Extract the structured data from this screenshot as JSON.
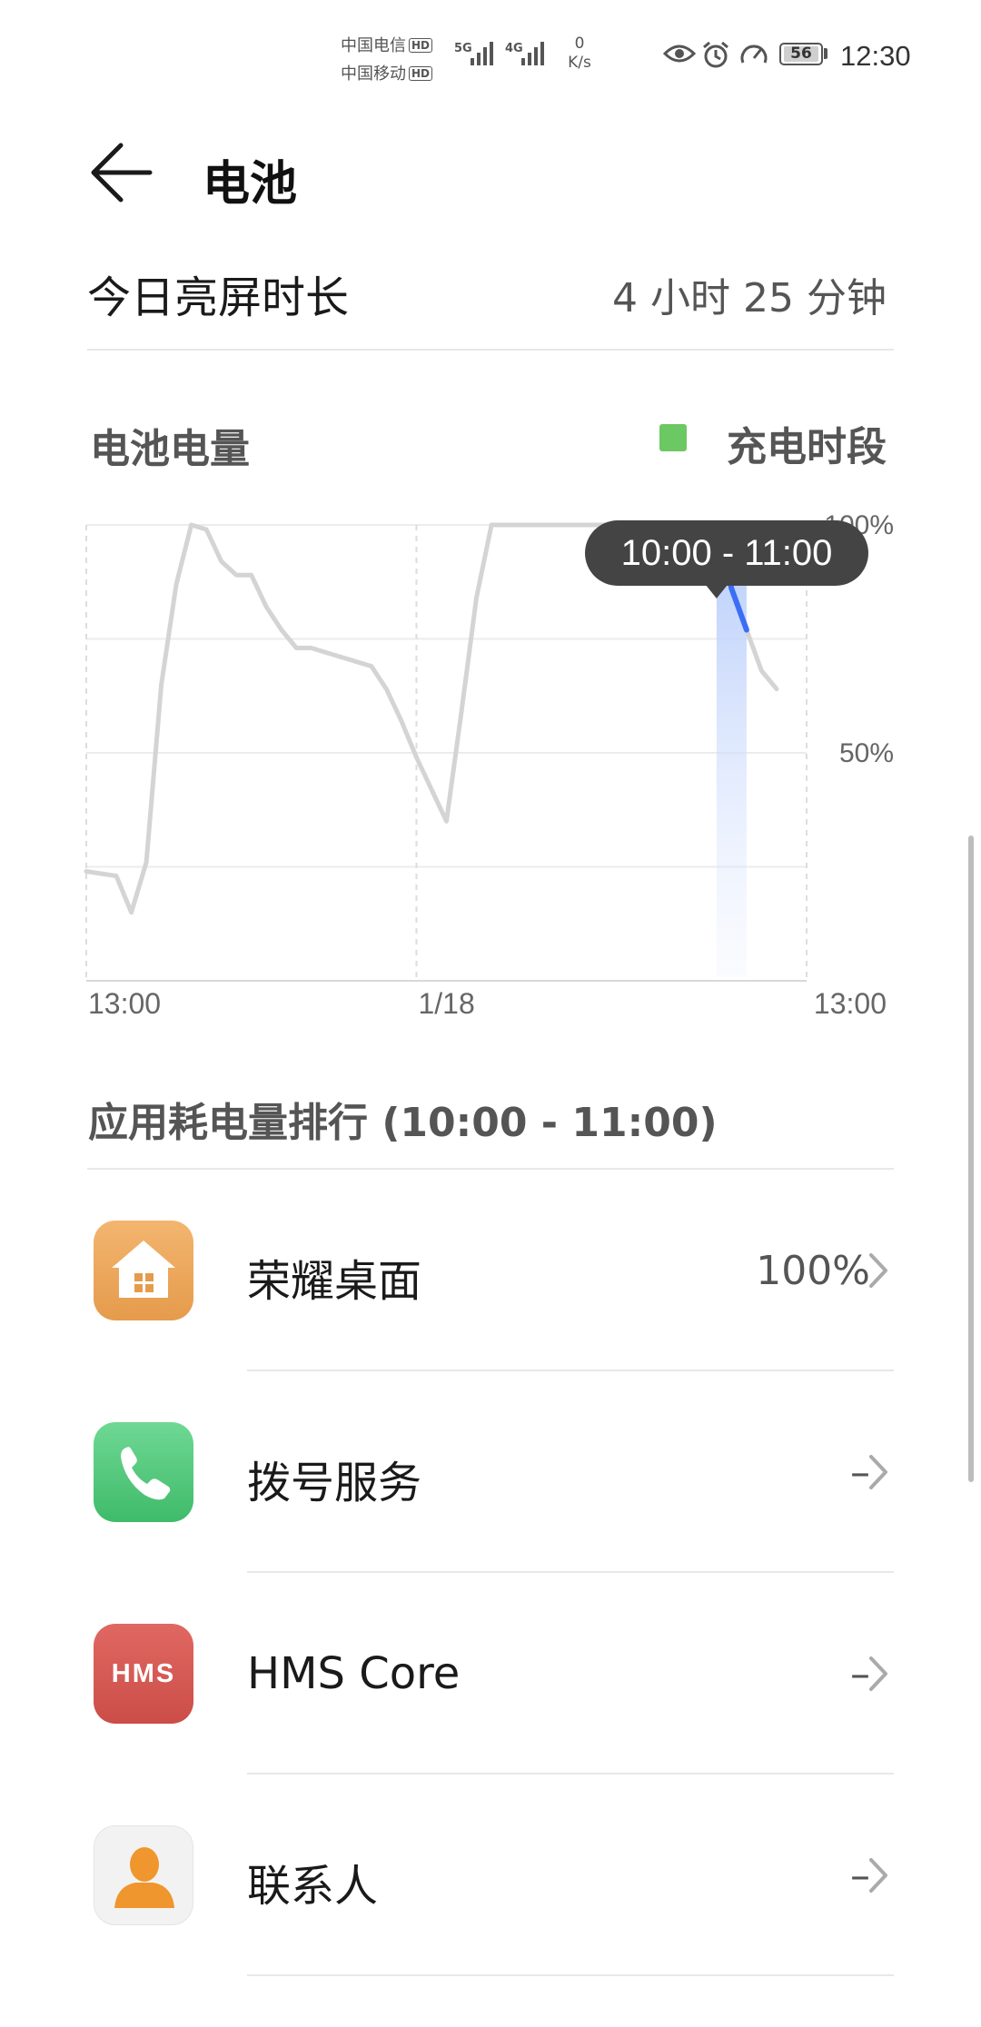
{
  "status_bar": {
    "carrier_1": "中国电信",
    "carrier_2": "中国移动",
    "hd_badge": "HD",
    "network_1": "5G",
    "network_2": "4G",
    "speed_value": "0",
    "speed_unit": "K/s",
    "battery_level": "56",
    "time": "12:30",
    "icons": [
      "eye-comfort-icon",
      "alarm-icon",
      "speedometer-icon"
    ]
  },
  "header": {
    "title": "电池"
  },
  "screen_time": {
    "label": "今日亮屏时长",
    "value": "4 小时 25 分钟"
  },
  "battery_chart": {
    "label": "电池电量",
    "legend": "充电时段",
    "legend_color": "#6cc862",
    "tooltip": "10:00 - 11:00",
    "highlight_color": "#3b6ef5"
  },
  "chart_data": {
    "type": "line",
    "x_tick_labels": [
      "13:00",
      "1/18",
      "13:00"
    ],
    "y_tick_labels": [
      "100%",
      "50%"
    ],
    "ylim": [
      0,
      100
    ],
    "x_unit": "hours since 13:00 on the first day",
    "x": [
      0,
      1,
      1.5,
      2,
      2.5,
      3,
      3.5,
      4,
      4.5,
      5,
      5.5,
      6,
      6.5,
      7,
      7.5,
      8,
      8.5,
      9,
      9.5,
      10,
      10.5,
      11,
      11.5,
      12,
      12.5,
      13,
      13.5,
      14,
      14.5,
      15,
      15.5,
      16,
      17,
      18,
      19,
      20,
      21,
      21.5,
      22,
      22.5,
      23
    ],
    "y": [
      24,
      23,
      15,
      26,
      65,
      87,
      100,
      99,
      92,
      89,
      89,
      82,
      77,
      73,
      73,
      72,
      71,
      70,
      69,
      64,
      57,
      49,
      42,
      35,
      59,
      84,
      100,
      100,
      100,
      100,
      100,
      100,
      100,
      100,
      100,
      100,
      100,
      86,
      77,
      68,
      64
    ],
    "highlight_range_x": [
      21,
      22
    ],
    "grid": true
  },
  "ranking": {
    "title": "应用耗电量排行 (10:00 - 11:00)",
    "apps": [
      {
        "name": "荣耀桌面",
        "value": "100%",
        "icon": "home-launcher-icon",
        "icon_color": "#e9a85c"
      },
      {
        "name": "拨号服务",
        "value": "–",
        "icon": "phone-icon",
        "icon_color": "#4fc778"
      },
      {
        "name": "HMS Core",
        "value": "–",
        "icon": "hms-core-icon",
        "icon_color": "#d95c56",
        "icon_text": "HMS"
      },
      {
        "name": "联系人",
        "value": "–",
        "icon": "contacts-icon",
        "icon_color": "#f0f0f0"
      }
    ]
  }
}
